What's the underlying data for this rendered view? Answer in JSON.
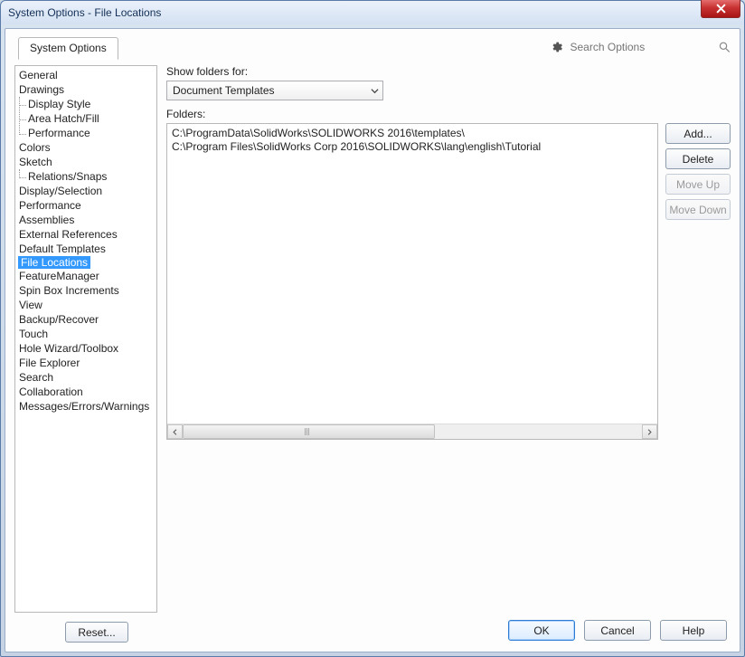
{
  "window": {
    "title": "System Options - File Locations"
  },
  "search": {
    "placeholder": "Search Options"
  },
  "tab": {
    "label": "System Options"
  },
  "tree": {
    "items": [
      {
        "label": "General"
      },
      {
        "label": "Drawings",
        "children": [
          {
            "label": "Display Style"
          },
          {
            "label": "Area Hatch/Fill"
          },
          {
            "label": "Performance"
          }
        ]
      },
      {
        "label": "Colors"
      },
      {
        "label": "Sketch",
        "children": [
          {
            "label": "Relations/Snaps"
          }
        ]
      },
      {
        "label": "Display/Selection"
      },
      {
        "label": "Performance"
      },
      {
        "label": "Assemblies"
      },
      {
        "label": "External References"
      },
      {
        "label": "Default Templates"
      },
      {
        "label": "File Locations",
        "selected": true
      },
      {
        "label": "FeatureManager"
      },
      {
        "label": "Spin Box Increments"
      },
      {
        "label": "View"
      },
      {
        "label": "Backup/Recover"
      },
      {
        "label": "Touch"
      },
      {
        "label": "Hole Wizard/Toolbox"
      },
      {
        "label": "File Explorer"
      },
      {
        "label": "Search"
      },
      {
        "label": "Collaboration"
      },
      {
        "label": "Messages/Errors/Warnings"
      }
    ]
  },
  "main": {
    "show_folders_label": "Show folders for:",
    "combo_value": "Document Templates",
    "folders_label": "Folders:",
    "folder_paths": [
      "C:\\ProgramData\\SolidWorks\\SOLIDWORKS 2016\\templates\\",
      "C:\\Program Files\\SolidWorks Corp 2016\\SOLIDWORKS\\lang\\english\\Tutorial"
    ],
    "buttons": {
      "add": "Add...",
      "delete": "Delete",
      "move_up": "Move Up",
      "move_down": "Move Down"
    }
  },
  "reset": {
    "label": "Reset..."
  },
  "footer": {
    "ok": "OK",
    "cancel": "Cancel",
    "help": "Help"
  }
}
